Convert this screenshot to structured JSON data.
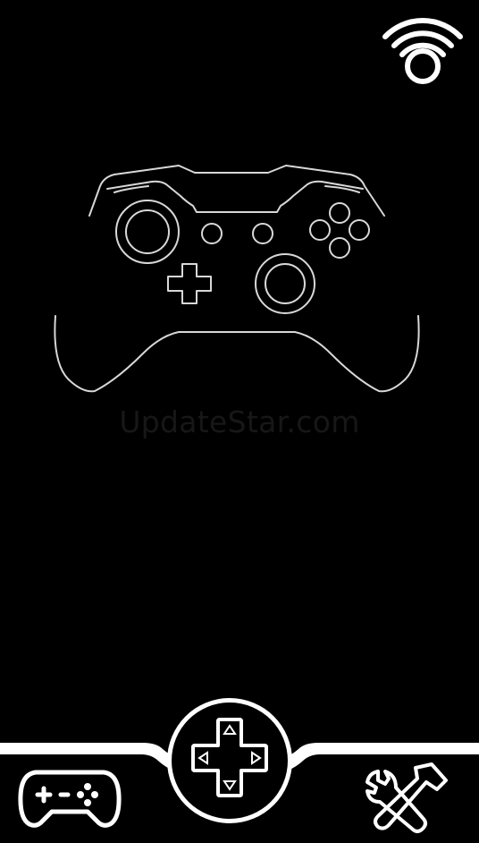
{
  "watermark": {
    "text": "UpdateStar.com"
  },
  "colors": {
    "background": "#000000",
    "outline": "#ffffff",
    "watermark": "#171717"
  },
  "icons": {
    "status": "wifi-icon",
    "main": "game-controller-icon",
    "nav": [
      "gamepad-icon",
      "dpad-icon",
      "tools-icon"
    ]
  }
}
